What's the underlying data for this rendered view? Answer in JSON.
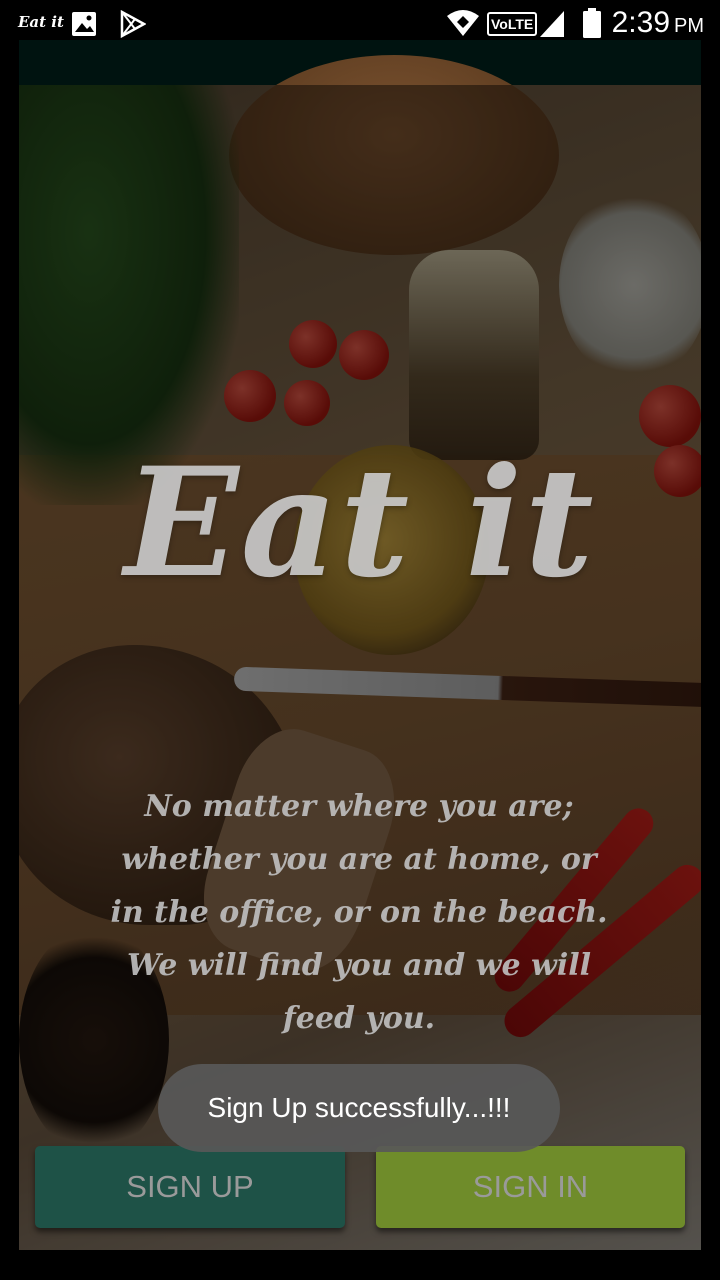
{
  "status_bar": {
    "app_label": "Eat it",
    "network": "VoLTE",
    "time": "2:39",
    "ampm": "PM",
    "icons": [
      "image-icon",
      "play-store-icon",
      "wifi-icon",
      "signal-icon",
      "battery-icon"
    ]
  },
  "main": {
    "logo": "Eat it",
    "tagline_lines": [
      "No matter where you are;",
      "whether you are at home, or",
      "in the office, or on the beach.",
      "We will find you and we will",
      "feed you."
    ]
  },
  "toast": {
    "message": "Sign Up successfully...!!!"
  },
  "buttons": {
    "sign_up": "SIGN UP",
    "sign_in": "SIGN IN"
  },
  "colors": {
    "sign_up_bg": "#1e5247",
    "sign_in_bg": "#6f8c2a",
    "action_bar": "#001310"
  }
}
